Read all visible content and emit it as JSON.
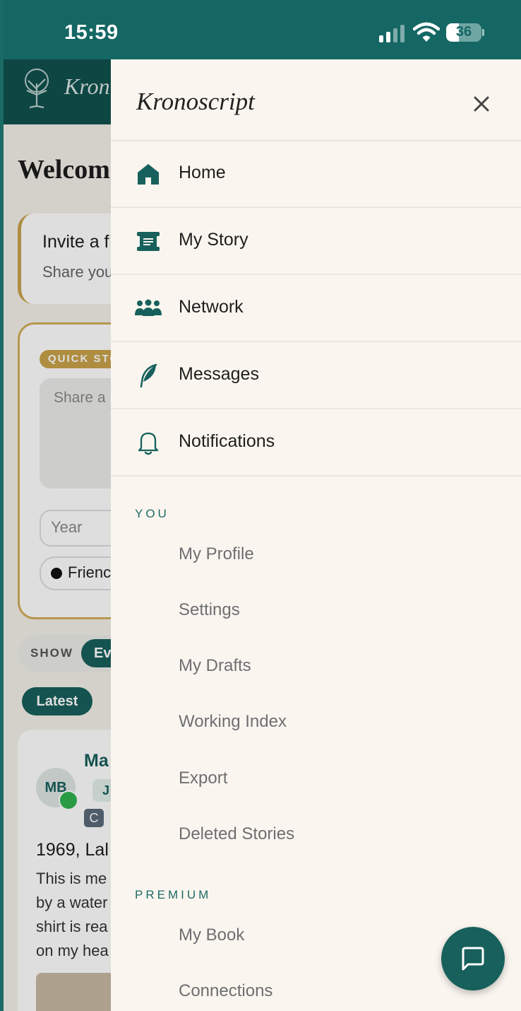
{
  "status_bar": {
    "time": "15:59",
    "battery": "36",
    "battery_level": 0.36
  },
  "background": {
    "brand": "Kron",
    "welcome": "Welcom",
    "invite_title": "Invite a f",
    "invite_sub": "Share you",
    "quick_story_tag": "QUICK STO",
    "quick_story_placeholder": "Share a",
    "year_placeholder": "Year",
    "audience": "Frienc",
    "show_label": "SHOW",
    "show_value": "Ev",
    "sort": "Latest",
    "post": {
      "avatar": "MB",
      "author": "Ma",
      "tag": "J",
      "repost_icon": "C",
      "title": "1969, Lal",
      "body_lines": [
        "This is me",
        "by a water",
        "shirt is rea",
        "on my hea"
      ]
    }
  },
  "drawer": {
    "title": "Kronoscript",
    "close_icon": "close-icon",
    "nav": [
      {
        "label": "Home",
        "icon": "home-icon"
      },
      {
        "label": "My Story",
        "icon": "scroll-icon"
      },
      {
        "label": "Network",
        "icon": "people-icon"
      },
      {
        "label": "Messages",
        "icon": "quill-icon"
      },
      {
        "label": "Notifications",
        "icon": "bell-icon"
      }
    ],
    "you": {
      "heading": "YOU",
      "items": [
        "My Profile",
        "Settings",
        "My Drafts",
        "Working Index",
        "Export",
        "Deleted Stories"
      ]
    },
    "premium": {
      "heading": "PREMIUM",
      "items": [
        "My Book",
        "Connections"
      ]
    }
  },
  "colors": {
    "brand": "#17605c",
    "status_bar": "#156764",
    "drawer_bg": "#faf6ef",
    "gold": "#c9a24a"
  }
}
